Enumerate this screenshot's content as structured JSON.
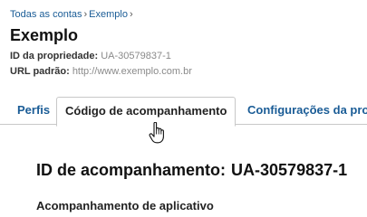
{
  "breadcrumb": {
    "items": [
      "Todas as contas",
      "Exemplo"
    ],
    "separator": "›"
  },
  "property": {
    "title": "Exemplo",
    "id_label": "ID da propriedade:",
    "id_value": "UA-30579837-1",
    "url_label": "URL padrão:",
    "url_value": "http://www.exemplo.com.br"
  },
  "tabs": [
    {
      "label": "Perfis",
      "active": false
    },
    {
      "label": "Código de acompanhamento",
      "active": true
    },
    {
      "label": "Configurações da pro",
      "active": false
    }
  ],
  "main": {
    "tracking_label": "ID de acompanhamento:",
    "tracking_value": "UA-30579837-1",
    "section_heading": "Acompanhamento de aplicativo"
  },
  "cursor": {
    "icon": "hand-pointer-icon"
  },
  "colors": {
    "link": "#1a5c96",
    "border": "#c8c8c8",
    "muted": "#8a8a8a"
  }
}
